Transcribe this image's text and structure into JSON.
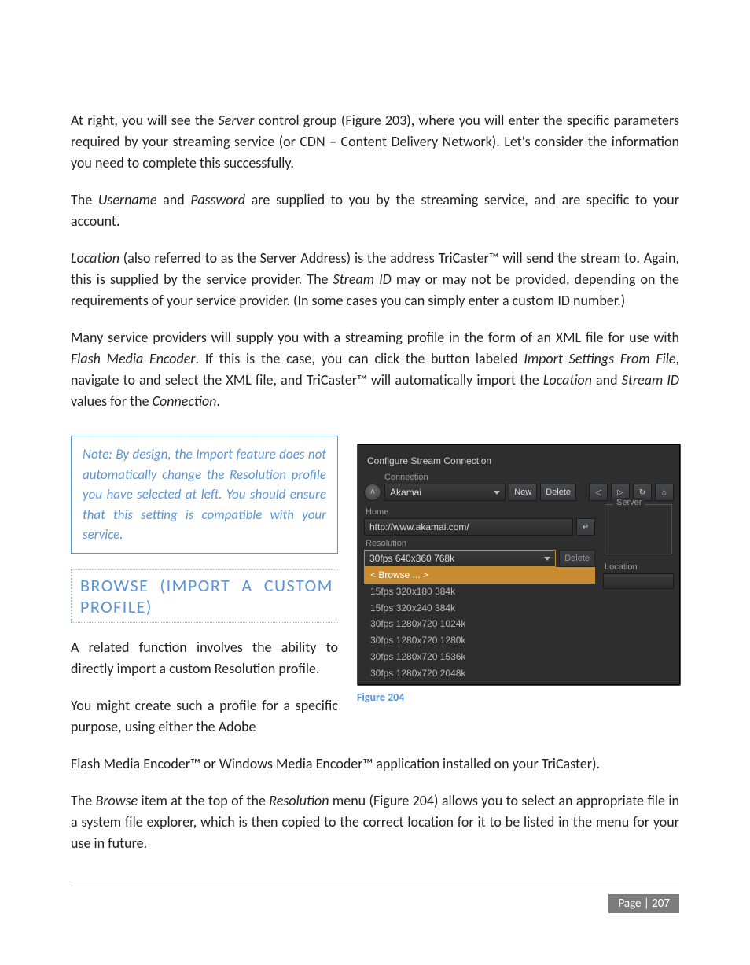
{
  "body": {
    "p1a": "At right, you will see the ",
    "p1b": "Server",
    "p1c": " control group (Figure 203), where you will enter the specific parameters required by your streaming service (or CDN – Content Delivery Network).  Let's consider the information you need to complete this successfully.",
    "p2a": "The ",
    "p2b": "Username",
    "p2c": " and ",
    "p2d": "Password",
    "p2e": " are supplied to you by the streaming service, and are specific to your account.",
    "p3a": " Location",
    "p3b": " (also referred to as the Server Address) is the address TriCaster™ will send the stream to.  Again, this is supplied by the service provider.  The ",
    "p3c": "Stream ID",
    "p3d": " may or may not be provided, depending on the requirements of your service provider.  (In some cases you can simply enter a custom ID number.)",
    "p4a": "Many service providers will supply you with a streaming profile in the form of an XML file for use with ",
    "p4b": "Flash Media Encoder",
    "p4c": ".  If this is the case, you can click the button labeled ",
    "p4d": "Import Settings From File",
    "p4e": ", navigate to and select the XML file, and TriCaster™ will automatically import the ",
    "p4f": "Location",
    "p4g": " and ",
    "p4h": "Stream ID",
    "p4i": " values for the ",
    "p4j": "Connection",
    "p4k": ".",
    "note": "Note:  By design, the Import feature does not automatically change the Resolution profile you have selected at left.  You should ensure that this setting is compatible with your service.",
    "h2": "BROWSE (IMPORT A CUSTOM PROFILE)",
    "p5a": "A related function involves the ability to directly import a custom ",
    "p5b": "Resolution",
    "p5c": " profile.",
    "p6": "You might create such a profile for a specific purpose, using either the Adobe",
    "p6cont": "Flash Media Encoder™ or Windows Media Encoder™ application installed on your TriCaster).",
    "p7a": "The ",
    "p7b": "Browse",
    "p7c": " item at the top of the ",
    "p7d": "Resolution",
    "p7e": " menu (Figure 204) allows you to select an appropriate file in a system file explorer, which is then copied to the correct location for it to be listed in the menu for your use in future.",
    "figcaption": "Figure 204",
    "page": "Page | 207"
  },
  "shot": {
    "title": "Configure Stream Connection",
    "conn_group": "Connection",
    "conn_value": "Akamai",
    "btn_new": "New",
    "btn_delete": "Delete",
    "home_label": "Home",
    "home_value": "http://www.akamai.com/",
    "res_label": "Resolution",
    "res_value": "30fps 640x360 768k",
    "res_delete": "Delete",
    "server_group": "Server",
    "location_label": "Location",
    "menu": {
      "browse": "< Browse ... >",
      "items": [
        "15fps 320x180 384k",
        "15fps 320x240 384k",
        "30fps 1280x720 1024k",
        "30fps 1280x720 1280k",
        "30fps 1280x720 1536k",
        "30fps 1280x720 2048k"
      ]
    }
  }
}
